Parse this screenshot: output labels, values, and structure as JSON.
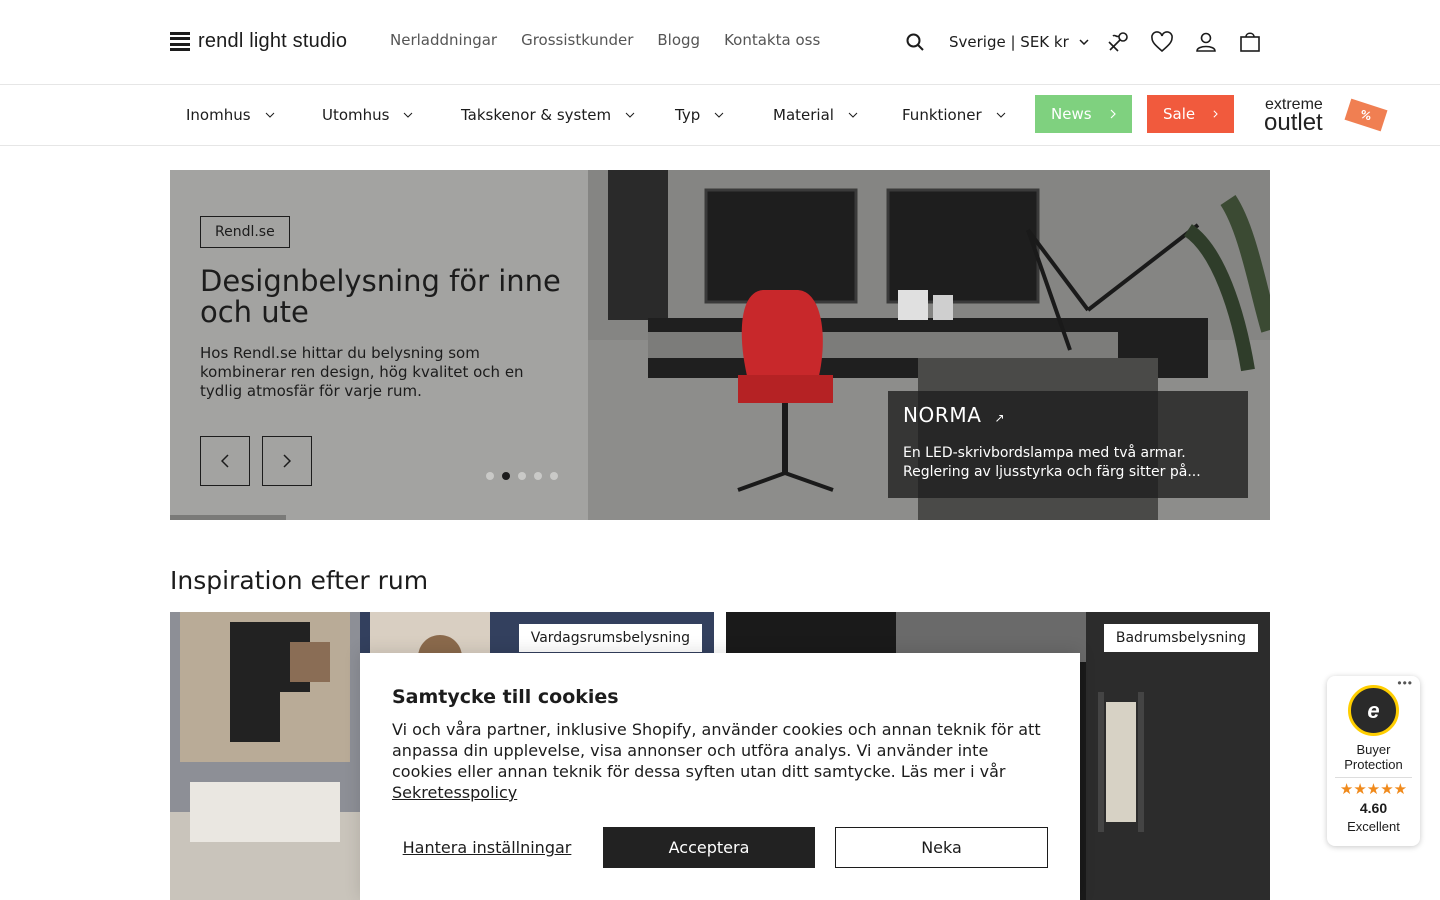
{
  "header": {
    "logo_text": "rendl light studio",
    "nav": [
      "Nerladdningar",
      "Grossistkunder",
      "Blogg",
      "Kontakta oss"
    ],
    "country_selector": "Sverige | SEK kr",
    "icons": [
      "search-icon",
      "store-locator-icon",
      "wishlist-icon",
      "account-icon",
      "cart-icon"
    ]
  },
  "categories": {
    "items": [
      "Inomhus",
      "Utomhus",
      "Takskenor & system",
      "Typ",
      "Material",
      "Funktioner"
    ],
    "news_label": "News",
    "sale_label": "Sale",
    "outlet_line1": "extreme",
    "outlet_line2": "outlet",
    "outlet_tag": "%"
  },
  "hero": {
    "badge": "Rendl.se",
    "title": "Designbelysning för inne och ute",
    "text": "Hos Rendl.se hittar du belysning som kombinerar ren design, hög kvalitet och en tydlig atmosfär för varje rum.",
    "slide_count": 5,
    "active_slide": 2,
    "caption_title": "NORMA",
    "caption_text": "En LED-skrivbordslampa med två armar. Reglering av ljusstyrka och färg sitter på..."
  },
  "inspiration": {
    "title": "Inspiration efter rum",
    "cards": [
      "Vardagsrumsbelysning",
      "Badrumsbelysning"
    ]
  },
  "cookie": {
    "title": "Samtycke till cookies",
    "text": "Vi och våra partner, inklusive Shopify, använder cookies och annan teknik för att anpassa din upplevelse, visa annonser och utföra analys. Vi använder inte cookies eller annan teknik för dessa syften utan ditt samtycke. Läs mer i vår",
    "link": "Sekretesspolicy",
    "manage": "Hantera inställningar",
    "accept": "Acceptera",
    "deny": "Neka"
  },
  "trustedshops": {
    "more": "•••",
    "seal_letter": "e",
    "label": "Buyer Protection",
    "stars": "★★★★★",
    "rating": "4.60",
    "rating_word": "Excellent"
  },
  "colors": {
    "news": "#7fd17f",
    "sale": "#f15a3d",
    "accent_dark": "#222222"
  }
}
